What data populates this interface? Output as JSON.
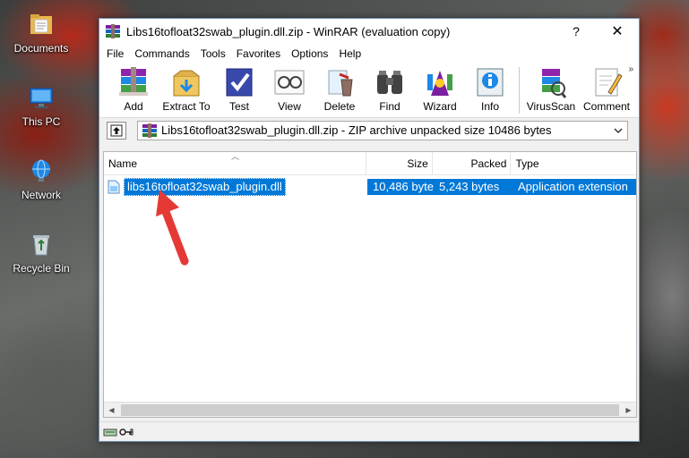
{
  "desktop": {
    "icons": [
      {
        "label": "Documents"
      },
      {
        "label": "This PC"
      },
      {
        "label": "Network"
      },
      {
        "label": "Recycle Bin"
      }
    ]
  },
  "window": {
    "title": "Libs16tofloat32swab_plugin.dll.zip - WinRAR (evaluation copy)",
    "help_label": "?",
    "close_label": "✕"
  },
  "menu": {
    "items": [
      "File",
      "Commands",
      "Tools",
      "Favorites",
      "Options",
      "Help"
    ]
  },
  "toolbar": {
    "buttons": [
      {
        "label": "Add",
        "icon": "add-icon"
      },
      {
        "label": "Extract To",
        "icon": "extract-icon"
      },
      {
        "label": "Test",
        "icon": "test-icon"
      },
      {
        "label": "View",
        "icon": "view-icon"
      },
      {
        "label": "Delete",
        "icon": "delete-icon"
      },
      {
        "label": "Find",
        "icon": "find-icon"
      },
      {
        "label": "Wizard",
        "icon": "wizard-icon"
      },
      {
        "label": "Info",
        "icon": "info-icon"
      },
      {
        "label": "VirusScan",
        "icon": "virusscan-icon"
      },
      {
        "label": "Comment",
        "icon": "comment-icon"
      }
    ],
    "more_label": "»"
  },
  "address": {
    "path": "Libs16tofloat32swab_plugin.dll.zip - ZIP archive unpacked size 10486 bytes"
  },
  "columns": {
    "name": "Name",
    "size": "Size",
    "packed": "Packed",
    "type": "Type"
  },
  "files": [
    {
      "name": "libs16tofloat32swab_plugin.dll",
      "size": "10,486 byte",
      "packed": "5,243 bytes",
      "type": "Application extension"
    }
  ],
  "colors": {
    "selection": "#0078d7",
    "arrow": "#e53935"
  }
}
